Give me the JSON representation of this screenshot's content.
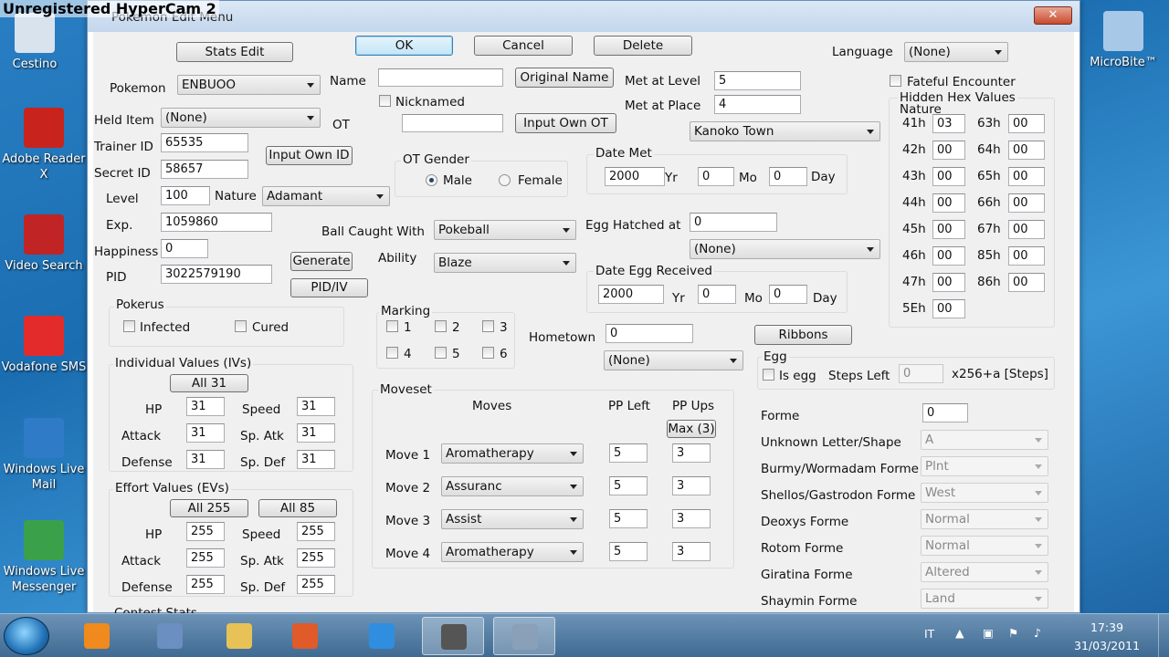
{
  "overlay": {
    "watermark": "Unregistered HyperCam 2"
  },
  "desktop": {
    "icons": [
      {
        "label": "Cestino",
        "color": "#d8e3ee"
      },
      {
        "label": "Adobe Reader X",
        "color": "#c8231d"
      },
      {
        "label": "Video Search",
        "color": "#c02424"
      },
      {
        "label": "Vodafone SMS",
        "color": "#e32b2b"
      },
      {
        "label": "Windows Live Mail",
        "color": "#2f7bc8"
      },
      {
        "label": "Windows Live Messenger",
        "color": "#3aa04a"
      }
    ],
    "right_icon": "MicroBite™"
  },
  "window": {
    "title": "Pokemon Edit Menu",
    "close_label": "✕"
  },
  "top_buttons": {
    "stats_edit": "Stats Edit",
    "ok": "OK",
    "cancel": "Cancel",
    "delete": "Delete"
  },
  "language": {
    "label": "Language",
    "value": "(None)"
  },
  "basic": {
    "pokemon_label": "Pokemon",
    "pokemon_value": "ENBUOO",
    "held_item_label": "Held Item",
    "held_item_value": "(None)",
    "trainer_id_label": "Trainer ID",
    "trainer_id_value": "65535",
    "secret_id_label": "Secret ID",
    "secret_id_value": "58657",
    "input_own_id": "Input Own ID",
    "level_label": "Level",
    "level_value": "100",
    "nature_label": "Nature",
    "nature_value": "Adamant",
    "exp_label": "Exp.",
    "exp_value": "1059860",
    "happiness_label": "Happiness",
    "happiness_value": "0",
    "pid_label": "PID",
    "pid_value": "3022579190",
    "generate": "Generate",
    "pid_iv": "PID/IV"
  },
  "name": {
    "name_label": "Name",
    "name_value": "",
    "original_name": "Original Name",
    "nicknamed_label": "Nicknamed",
    "ot_label": "OT",
    "ot_value": "",
    "input_own_ot": "Input Own OT",
    "ot_gender_label": "OT Gender",
    "male": "Male",
    "female": "Female"
  },
  "met": {
    "met_level_label": "Met at Level",
    "met_level_value": "5",
    "met_place_label": "Met at Place",
    "met_place_value": "4",
    "met_place_combo": "Kanoko Town",
    "date_met_label": "Date Met",
    "date_met_yr": "2000",
    "date_met_mo": "0",
    "date_met_day": "0",
    "yr": "Yr",
    "mo": "Mo",
    "day": "Day",
    "egg_hatched_label": "Egg Hatched at",
    "egg_hatched_value": "0",
    "egg_hatched_combo": "(None)",
    "date_egg_label": "Date Egg Received",
    "date_egg_yr": "2000",
    "date_egg_mo": "0",
    "date_egg_day": "0"
  },
  "ball": {
    "label": "Ball Caught With",
    "value": "Pokeball"
  },
  "ability": {
    "label": "Ability",
    "value": "Blaze"
  },
  "fateful": {
    "label": "Fateful Encounter"
  },
  "hex": {
    "title": "Hidden Hex Values",
    "subtitle": "Nature",
    "rows": [
      {
        "a_label": "41h",
        "a_value": "03",
        "b_label": "63h",
        "b_value": "00"
      },
      {
        "a_label": "42h",
        "a_value": "00",
        "b_label": "64h",
        "b_value": "00"
      },
      {
        "a_label": "43h",
        "a_value": "00",
        "b_label": "65h",
        "b_value": "00"
      },
      {
        "a_label": "44h",
        "a_value": "00",
        "b_label": "66h",
        "b_value": "00"
      },
      {
        "a_label": "45h",
        "a_value": "00",
        "b_label": "67h",
        "b_value": "00"
      },
      {
        "a_label": "46h",
        "a_value": "00",
        "b_label": "85h",
        "b_value": "00"
      },
      {
        "a_label": "47h",
        "a_value": "00",
        "b_label": "86h",
        "b_value": "00"
      },
      {
        "a_label": "5Eh",
        "a_value": "00"
      }
    ]
  },
  "pokerus": {
    "title": "Pokerus",
    "infected": "Infected",
    "cured": "Cured"
  },
  "marking": {
    "title": "Marking",
    "items": [
      "1",
      "2",
      "3",
      "4",
      "5",
      "6"
    ]
  },
  "hometown": {
    "label": "Hometown",
    "value": "0",
    "combo": "(None)"
  },
  "ribbons": {
    "label": "Ribbons"
  },
  "egg": {
    "title": "Egg",
    "is_egg": "Is egg",
    "steps_left": "Steps Left",
    "steps_value": "0",
    "steps_unit": "x256+a [Steps]"
  },
  "ivs": {
    "title": "Individual Values (IVs)",
    "all": "All 31",
    "hp_label": "HP",
    "hp": "31",
    "speed_label": "Speed",
    "speed": "31",
    "attack_label": "Attack",
    "attack": "31",
    "spatk_label": "Sp. Atk",
    "spatk": "31",
    "defense_label": "Defense",
    "defense": "31",
    "spdef_label": "Sp. Def",
    "spdef": "31"
  },
  "evs": {
    "title": "Effort Values (EVs)",
    "all255": "All 255",
    "all85": "All 85",
    "hp_label": "HP",
    "hp": "255",
    "speed_label": "Speed",
    "speed": "255",
    "attack_label": "Attack",
    "attack": "255",
    "spatk_label": "Sp. Atk",
    "spatk": "255",
    "defense_label": "Defense",
    "defense": "255",
    "spdef_label": "Sp. Def",
    "spdef": "255"
  },
  "contest": {
    "title": "Contest Stats"
  },
  "moveset": {
    "title": "Moveset",
    "moves_header": "Moves",
    "pp_left_header": "PP Left",
    "pp_ups_header": "PP Ups",
    "max": "Max (3)",
    "moves": [
      {
        "label": "Move 1",
        "name": "Aromatherapy",
        "pp": "5",
        "ups": "3"
      },
      {
        "label": "Move 2",
        "name": "Assuranc",
        "pp": "5",
        "ups": "3"
      },
      {
        "label": "Move 3",
        "name": "Assist",
        "pp": "5",
        "ups": "3"
      },
      {
        "label": "Move 4",
        "name": "Aromatherapy",
        "pp": "5",
        "ups": "3"
      }
    ]
  },
  "forme": {
    "rows": [
      {
        "label": "Forme",
        "value": "0",
        "kind": "text"
      },
      {
        "label": "Unknown Letter/Shape",
        "value": "A",
        "kind": "combo"
      },
      {
        "label": "Burmy/Wormadam Forme",
        "value": "Plnt",
        "kind": "combo"
      },
      {
        "label": "Shellos/Gastrodon Forme",
        "value": "West",
        "kind": "combo"
      },
      {
        "label": "Deoxys Forme",
        "value": "Normal",
        "kind": "combo"
      },
      {
        "label": "Rotom Forme",
        "value": "Normal",
        "kind": "combo"
      },
      {
        "label": "Giratina Forme",
        "value": "Altered",
        "kind": "combo"
      },
      {
        "label": "Shaymin Forme",
        "value": "Land",
        "kind": "combo"
      }
    ]
  },
  "taskbar": {
    "language": "IT",
    "time": "17:39",
    "date": "31/03/2011",
    "apps": [
      {
        "name": "media-player",
        "color": "#f08a1c"
      },
      {
        "name": "editor",
        "color": "#6a8fc0"
      },
      {
        "name": "explorer",
        "color": "#e8c257"
      },
      {
        "name": "app",
        "color": "#e05a2a"
      },
      {
        "name": "internet-explorer",
        "color": "#2f8ee0"
      },
      {
        "name": "hypercam",
        "color": "#555"
      },
      {
        "name": "pokesav",
        "color": "#8aa0b8"
      }
    ]
  }
}
